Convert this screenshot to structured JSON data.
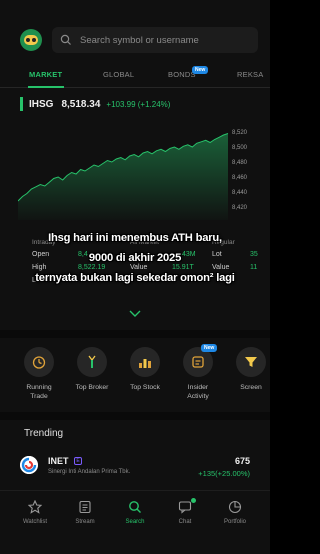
{
  "header": {
    "search_placeholder": "Search symbol or username"
  },
  "tabs": [
    {
      "label": "MARKET",
      "active": true
    },
    {
      "label": "GLOBAL",
      "active": false
    },
    {
      "label": "BONDS",
      "active": false,
      "badge": "New"
    },
    {
      "label": "REKSA",
      "active": false
    }
  ],
  "ticker": {
    "symbol": "IHSG",
    "price": "8,518.34",
    "change": "+103.99 (+1.24%)"
  },
  "chart_data": {
    "type": "area",
    "y_ticks": [
      "8,520",
      "8,500",
      "8,480",
      "8,460",
      "8,440",
      "8,420"
    ],
    "ylim": [
      8410,
      8530
    ],
    "values": [
      8430,
      8436,
      8440,
      8446,
      8449,
      8452,
      8450,
      8455,
      8460,
      8462,
      8458,
      8464,
      8468,
      8466,
      8472,
      8470,
      8474,
      8478,
      8476,
      8480,
      8484,
      8482,
      8486,
      8488,
      8485,
      8490,
      8492,
      8489,
      8494,
      8496,
      8493,
      8497,
      8499,
      8496,
      8500,
      8502,
      8499,
      8503,
      8505,
      8502,
      8507,
      8509,
      8511,
      8508,
      8512,
      8515,
      8518,
      8520
    ],
    "color": "#27c26a"
  },
  "stats": {
    "intraday_label": "Intraday",
    "all_market_label": "All Market",
    "regular_label": "Regular",
    "open_label": "Open",
    "open_value": "8,4",
    "high_label": "High",
    "high_value": "8,522.19",
    "value_label": "Value",
    "value_value": "15.91T",
    "volume_value": "43M",
    "lot_label": "Lot",
    "lot_value": "35",
    "value2_label": "Value",
    "value2_value": "11",
    "low_label": "Lo"
  },
  "overlay": {
    "line1": "Ihsg hari ini menembus ATH baru,",
    "line2": "9000 di akhir 2025",
    "line3": "ternyata bukan lagi sekedar omon² lagi"
  },
  "shortcuts": [
    {
      "label": "Running Trade",
      "icon": "running-trade-icon"
    },
    {
      "label": "Top Broker",
      "icon": "top-broker-icon"
    },
    {
      "label": "Top Stock",
      "icon": "top-stock-icon"
    },
    {
      "label": "Insider Activity",
      "icon": "insider-activity-icon",
      "badge": "New"
    },
    {
      "label": "Screen",
      "icon": "screener-icon"
    }
  ],
  "trending": {
    "title": "Trending",
    "items": [
      {
        "code": "INET",
        "tag": "E",
        "name": "Sinergi Inti Andalan Prima Tbk.",
        "price": "675",
        "change": "+135(+25.00%)"
      }
    ]
  },
  "bottom_nav": [
    {
      "label": "Watchlist",
      "icon": "star-icon"
    },
    {
      "label": "Stream",
      "icon": "stream-icon"
    },
    {
      "label": "Search",
      "icon": "search-icon",
      "active": true
    },
    {
      "label": "Chat",
      "icon": "chat-icon"
    },
    {
      "label": "Portfolio",
      "icon": "portfolio-icon"
    }
  ]
}
